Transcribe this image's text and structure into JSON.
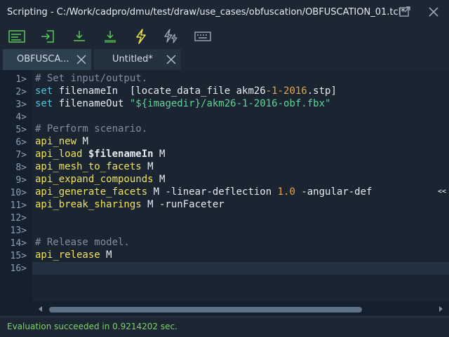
{
  "window": {
    "title": "Scripting - C:/Work/cadpro/dmu/test/draw/use_cases/obfuscation/OBFUSCATION_01.tcl*"
  },
  "tabs": [
    {
      "label": "OBFUSCA..."
    },
    {
      "label": "Untitled*"
    }
  ],
  "editor": {
    "line_numbers": [
      "1>",
      "2>",
      "3>",
      "4>",
      "5>",
      "6>",
      "7>",
      "8>",
      "9>",
      "10>",
      "11>",
      "12>",
      "13>",
      "14>",
      "15>",
      "16>"
    ],
    "tokens": {
      "l1": "# Set input/output.",
      "l2_kw": "set",
      "l2_rest": " filenameIn  [locate_data_file akm26",
      "l2_n1": "-1-2016",
      "l2_end": ".stp]",
      "l3_kw": "set",
      "l3_rest": " filenameOut ",
      "l3_str": "\"${imagedir}/akm26-1-2016-obf.fbx\"",
      "l5": "# Perform scenario.",
      "l6_fn": "api_new",
      "l6_rest": " M",
      "l7_fn": "api_load",
      "l7_var": " $filenameIn",
      "l7_rest": " M",
      "l8_fn": "api_mesh_to_facets",
      "l8_rest": " M",
      "l9_fn": "api_expand_compounds",
      "l9_rest": " M",
      "l10_fn": "api_generate_facets",
      "l10_rest": " M -linear-deflection ",
      "l10_num": "1.0",
      "l10_end": " -angular-def",
      "l11_fn": "api_break_sharings",
      "l11_rest": " M -runFaceter",
      "l14": "# Release model.",
      "l15_fn": "api_release",
      "l15_rest": " M"
    },
    "overflow_marker": "<<"
  },
  "status": {
    "message": "Evaluation succeeded in 0.9214202 sec."
  },
  "colors": {
    "keyword": "#f0e35c",
    "set_keyword": "#4fc3dc",
    "comment": "#7f8f9f",
    "number": "#e3a64a",
    "string": "#5fd39a",
    "status_ok": "#7cd36a"
  }
}
